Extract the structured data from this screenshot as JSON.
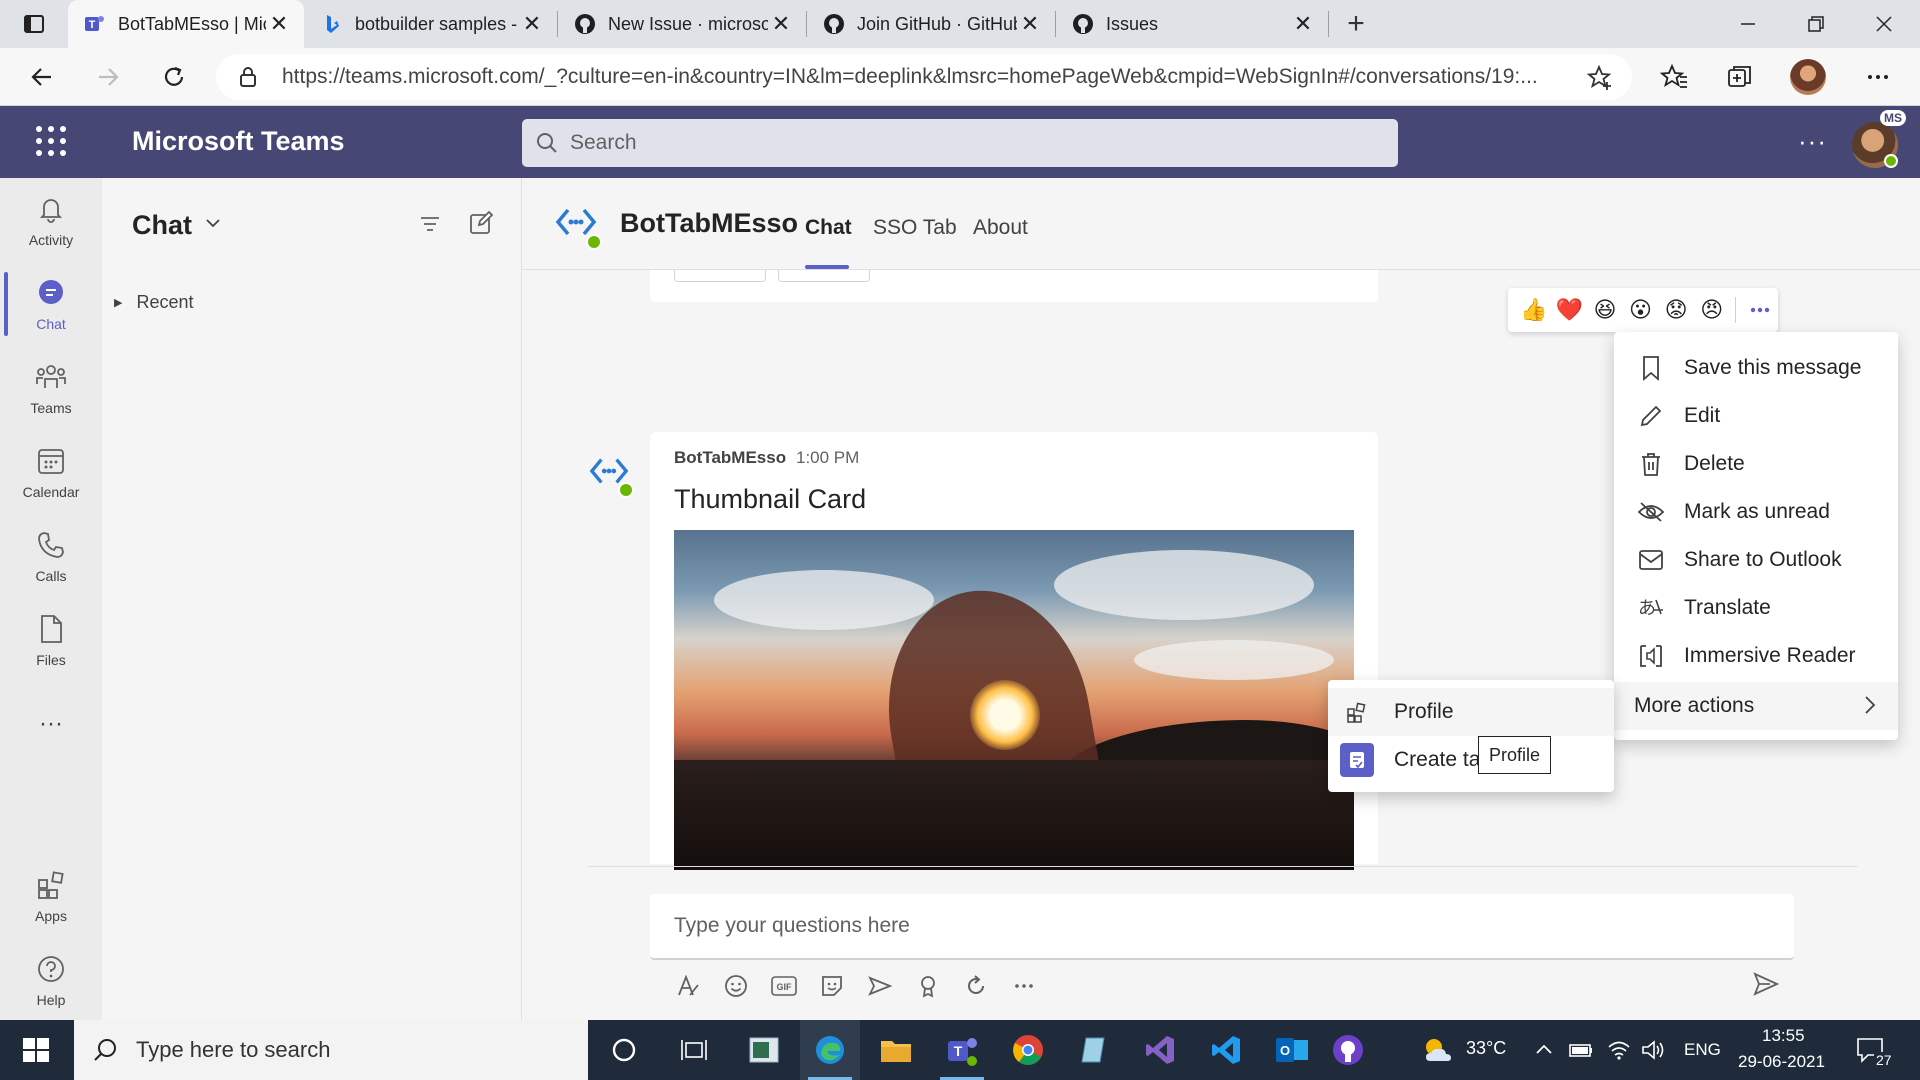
{
  "browser": {
    "tabs": [
      {
        "title": "BotTabMEsso | Microsoft T",
        "active": true,
        "icon": "teams-icon"
      },
      {
        "title": "botbuilder samples - Bing",
        "active": false,
        "icon": "bing-icon"
      },
      {
        "title": "New Issue · microsoft/Bot",
        "active": false,
        "icon": "github-icon"
      },
      {
        "title": "Join GitHub · GitHub",
        "active": false,
        "icon": "github-icon"
      },
      {
        "title": "Issues",
        "active": false,
        "icon": "github-icon"
      }
    ],
    "close_glyph": "✕",
    "new_tab_glyph": "+",
    "url": "https://teams.microsoft.com/_?culture=en-in&country=IN&lm=deeplink&lmsrc=homePageWeb&cmpid=WebSignIn#/conversations/19:..."
  },
  "teams": {
    "app_title": "Microsoft Teams",
    "search_placeholder": "Search",
    "more_glyph": "···",
    "user_badge": "MS",
    "rail": [
      {
        "label": "Activity",
        "icon": "bell-icon"
      },
      {
        "label": "Chat",
        "icon": "chat-icon",
        "active": true
      },
      {
        "label": "Teams",
        "icon": "teams-icon"
      },
      {
        "label": "Calendar",
        "icon": "calendar-icon"
      },
      {
        "label": "Calls",
        "icon": "phone-icon"
      },
      {
        "label": "Files",
        "icon": "file-icon"
      }
    ],
    "rail_more": "···",
    "rail_bottom": [
      {
        "label": "Apps",
        "icon": "apps-icon"
      },
      {
        "label": "Help",
        "icon": "help-icon"
      }
    ],
    "chat_list": {
      "title": "Chat",
      "recent_label": "Recent"
    },
    "conversation": {
      "bot_name": "BotTabMEsso",
      "tabs": [
        "Chat",
        "SSO Tab",
        "About"
      ],
      "active_tab": "Chat",
      "message": {
        "author": "BotTabMEsso",
        "time": "1:00 PM",
        "card_title": "Thumbnail Card"
      },
      "compose_placeholder": "Type your questions here"
    },
    "reactions": [
      "👍",
      "❤️",
      "😆",
      "😮",
      "😟",
      "😠"
    ],
    "context_menu": {
      "items": [
        {
          "label": "Save this message",
          "icon": "bookmark-icon"
        },
        {
          "label": "Edit",
          "icon": "pencil-icon"
        },
        {
          "label": "Delete",
          "icon": "trash-icon"
        },
        {
          "label": "Mark as unread",
          "icon": "eye-off-icon"
        },
        {
          "label": "Share to Outlook",
          "icon": "mail-icon"
        },
        {
          "label": "Translate",
          "icon": "translate-icon"
        },
        {
          "label": "Immersive Reader",
          "icon": "immersive-reader-icon"
        }
      ],
      "more_actions": "More actions"
    },
    "submenu": {
      "items": [
        {
          "label": "Profile",
          "icon": "profile-app-icon"
        },
        {
          "label": "Create ta",
          "icon": "create-task-icon"
        }
      ],
      "tooltip": "Profile"
    }
  },
  "taskbar": {
    "search_placeholder": "Type here to search",
    "weather": "33°C",
    "language": "ENG",
    "time": "13:55",
    "date": "29-06-2021",
    "notification_count": "27"
  },
  "colors": {
    "teams_purple": "#464775",
    "accent": "#5b5fc7",
    "presence_green": "#6bb700"
  }
}
